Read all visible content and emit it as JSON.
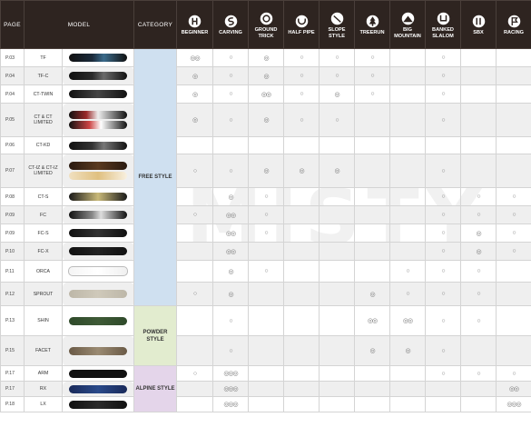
{
  "header": {
    "page": "PAGE",
    "model": "MODEL",
    "category": "CATEGORY",
    "columns": [
      {
        "label": "BEGINNER",
        "icon": "beginner-icon"
      },
      {
        "label": "CARVING",
        "icon": "carving-icon"
      },
      {
        "label": "GROUND TRICK",
        "icon": "ground-trick-icon"
      },
      {
        "label": "HALF PIPE",
        "icon": "half-pipe-icon"
      },
      {
        "label": "SLOPE STYLE",
        "icon": "slope-style-icon"
      },
      {
        "label": "TREERUN",
        "icon": "tree-icon"
      },
      {
        "label": "BIG MOUNTAIN",
        "icon": "mountain-icon"
      },
      {
        "label": "BANKED SLALOM",
        "icon": "banked-slalom-icon"
      },
      {
        "label": "SBX",
        "icon": "sbx-icon"
      },
      {
        "label": "RACING",
        "icon": "racing-icon"
      }
    ]
  },
  "categories": {
    "free": "FREE STYLE",
    "powder": "POWDER STYLE",
    "alpine": "ALPINE STYLE"
  },
  "watermark": "MISTY",
  "rows": [
    {
      "page": "P.03",
      "model": "TF",
      "marks": [
        "◎◎",
        "○",
        "◎",
        "○",
        "○",
        "○",
        "",
        "○",
        "",
        ""
      ]
    },
    {
      "page": "P.04",
      "model": "TF-C",
      "marks": [
        "◎",
        "○",
        "◎",
        "○",
        "○",
        "○",
        "",
        "○",
        "",
        ""
      ]
    },
    {
      "page": "P.04",
      "model": "CT-TWIN",
      "marks": [
        "◎",
        "○",
        "◎◎",
        "○",
        "◎",
        "○",
        "",
        "○",
        "",
        ""
      ]
    },
    {
      "page": "P.05",
      "model": "CT & CT LIMITED",
      "marks": [
        "◎",
        "○",
        "◎",
        "○",
        "○",
        "",
        "",
        "○",
        "",
        ""
      ]
    },
    {
      "page": "P.06",
      "model": "CT-KD",
      "marks": [
        "",
        "",
        "",
        "",
        "",
        "",
        "",
        "",
        "",
        ""
      ]
    },
    {
      "page": "P.07",
      "model": "CT-IZ & CT-IZ LIMITED",
      "marks": [
        "○",
        "○",
        "◎",
        "◎",
        "◎",
        "",
        "",
        "○",
        "",
        ""
      ]
    },
    {
      "page": "P.08",
      "model": "CT-S",
      "marks": [
        "",
        "◎",
        "○",
        "",
        "",
        "",
        "",
        "○",
        "○",
        "○"
      ]
    },
    {
      "page": "P.09",
      "model": "FC",
      "marks": [
        "○",
        "◎◎",
        "○",
        "",
        "",
        "",
        "",
        "○",
        "○",
        "○"
      ]
    },
    {
      "page": "P.09",
      "model": "FC-S",
      "marks": [
        "",
        "◎◎",
        "○",
        "",
        "",
        "",
        "",
        "○",
        "◎",
        "○"
      ]
    },
    {
      "page": "P.10",
      "model": "FC-X",
      "marks": [
        "",
        "◎◎",
        "",
        "",
        "",
        "",
        "",
        "○",
        "◎",
        "○"
      ]
    },
    {
      "page": "P.11",
      "model": "ORCA",
      "marks": [
        "",
        "◎",
        "○",
        "",
        "",
        "",
        "○",
        "○",
        "○",
        ""
      ]
    },
    {
      "page": "P.12",
      "model": "SPROUT",
      "marks": [
        "○",
        "◎",
        "",
        "",
        "",
        "◎",
        "○",
        "○",
        "○",
        ""
      ]
    },
    {
      "page": "P.13",
      "model": "SHIN",
      "marks": [
        "",
        "○",
        "",
        "",
        "",
        "◎◎",
        "◎◎",
        "○",
        "○",
        ""
      ]
    },
    {
      "page": "P.15",
      "model": "FACET",
      "marks": [
        "",
        "○",
        "",
        "",
        "",
        "◎",
        "◎",
        "○",
        "",
        ""
      ]
    },
    {
      "page": "P.17",
      "model": "ARM",
      "marks": [
        "○",
        "◎◎◎",
        "",
        "",
        "",
        "",
        "",
        "○",
        "○",
        "○"
      ]
    },
    {
      "page": "P.17",
      "model": "RX",
      "marks": [
        "",
        "◎◎◎",
        "",
        "",
        "",
        "",
        "",
        "",
        "",
        "◎◎"
      ]
    },
    {
      "page": "P.18",
      "model": "LX",
      "marks": [
        "",
        "◎◎◎",
        "",
        "",
        "",
        "",
        "",
        "",
        "",
        "◎◎◎"
      ]
    }
  ],
  "colors": {
    "header_bg": "#2e2420",
    "free_bg": "#cfe0f0",
    "powder_bg": "#e2eccf",
    "alpine_bg": "#e4d5ea"
  }
}
